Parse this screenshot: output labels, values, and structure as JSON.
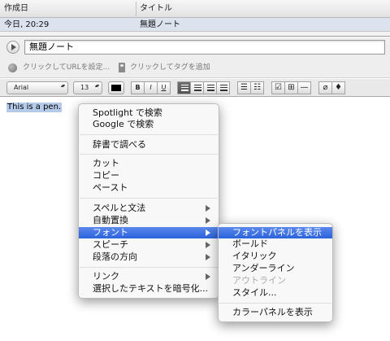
{
  "note_list": {
    "columns": [
      "作成日",
      "タイトル"
    ],
    "rows": [
      {
        "created": "今日, 20:29",
        "title": "無題ノート"
      }
    ]
  },
  "editor_header": {
    "title_value": "無題ノート",
    "url_placeholder": "クリックしてURLを設定...",
    "tag_placeholder": "クリックしてタグを追加"
  },
  "toolbar": {
    "font_name": "Arial",
    "font_size": "13",
    "text_color": "#000000",
    "bold_label": "B",
    "italic_label": "I",
    "underline_label": "U",
    "selected_alignment": "left",
    "icons": [
      "color-swatch-icon",
      "align-left-icon",
      "align-center-icon",
      "align-right-icon",
      "align-justify-icon",
      "bullet-list-icon",
      "numbered-list-icon",
      "checkbox-icon",
      "table-icon",
      "horizontal-rule-icon",
      "attachment-icon",
      "microphone-icon"
    ]
  },
  "editor": {
    "selected_text": "This is a pen."
  },
  "context_menu": {
    "groups": [
      [
        {
          "label": "Spotlight で検索"
        },
        {
          "label": "Google で検索"
        }
      ],
      [
        {
          "label": "辞書で調べる"
        }
      ],
      [
        {
          "label": "カット"
        },
        {
          "label": "コピー"
        },
        {
          "label": "ペースト"
        }
      ],
      [
        {
          "label": "スペルと文法",
          "submenu": true
        },
        {
          "label": "自動置換",
          "submenu": true
        },
        {
          "label": "フォント",
          "submenu": true,
          "highlighted": true
        },
        {
          "label": "スピーチ",
          "submenu": true
        },
        {
          "label": "段落の方向",
          "submenu": true
        }
      ],
      [
        {
          "label": "リンク",
          "submenu": true
        },
        {
          "label": "選択したテキストを暗号化..."
        }
      ]
    ]
  },
  "font_submenu": {
    "items": [
      {
        "label": "フォントパネルを表示",
        "highlighted": true
      },
      {
        "label": "ボールド"
      },
      {
        "label": "イタリック"
      },
      {
        "label": "アンダーライン"
      },
      {
        "label": "アウトライン",
        "disabled": true
      },
      {
        "label": "スタイル..."
      }
    ],
    "footer_items": [
      {
        "label": "カラーパネルを表示"
      }
    ]
  },
  "colors": {
    "selection_highlight": "#b5cbe9",
    "menu_highlight": "#2a63dc",
    "selected_row": "#dce3ee"
  }
}
